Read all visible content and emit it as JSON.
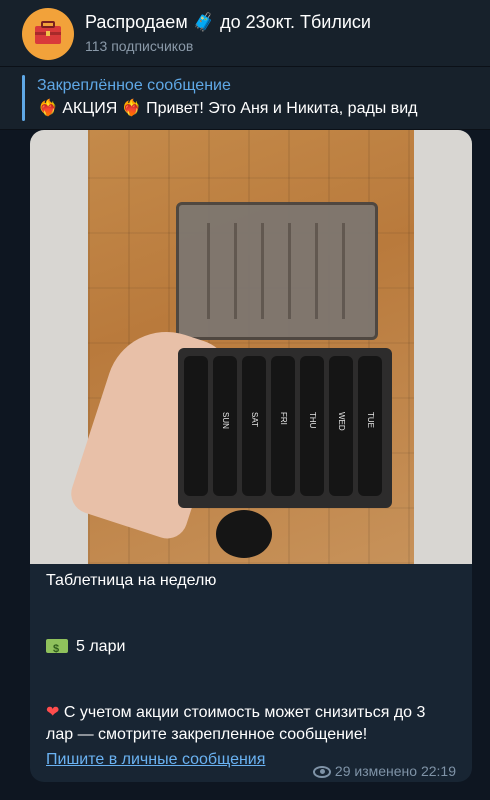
{
  "header": {
    "title": "Распродаем 🧳 до 23окт. Тбилиси",
    "subscribers": "113 подписчиков"
  },
  "pinned": {
    "label": "Закреплённое сообщение",
    "preview": "❤️‍🔥 АКЦИЯ ❤️‍🔥  Привет! Это Аня и Никита, рады вид"
  },
  "message": {
    "photo_labels": [
      "SUN",
      "SAT",
      "FRI",
      "THU",
      "WED",
      "TUE"
    ],
    "caption": {
      "line1": "Таблетница на неделю",
      "line2": "5 лари",
      "line3": "С учетом акции стоимость может снизиться до 3 лар — смотрите закрепленное сообщение!"
    },
    "link": "Пишите в личные сообщения",
    "meta": "29 изменено 22:19"
  },
  "colors": {
    "background": "#0e1621",
    "panel": "#17212b",
    "bubble": "#182533",
    "accent": "#5fa8e6",
    "link": "#6ab2f2"
  },
  "icons": [
    "chest-icon",
    "money-icon",
    "heart-fire-icon",
    "eye-icon"
  ]
}
